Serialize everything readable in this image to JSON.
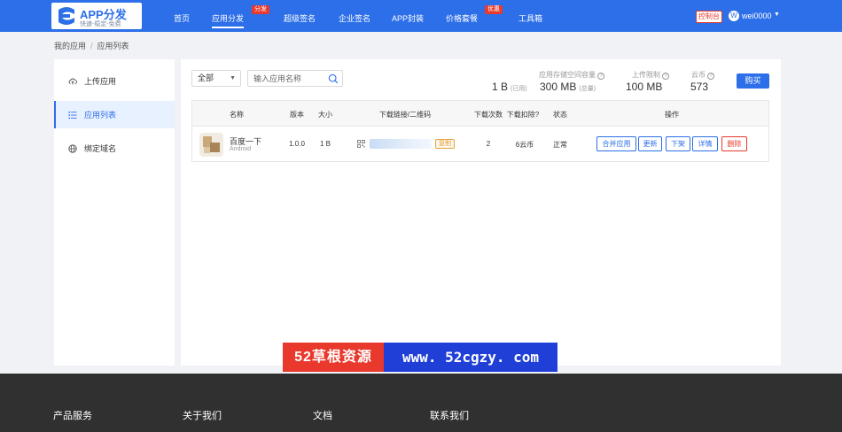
{
  "header": {
    "logo_title": "APP分发",
    "logo_subtitle": "快速-稳定-免费",
    "nav": [
      {
        "label": "首页"
      },
      {
        "label": "应用分发",
        "badge": "分发",
        "active": true
      },
      {
        "label": "超级签名"
      },
      {
        "label": "企业签名"
      },
      {
        "label": "APP封装"
      },
      {
        "label": "价格套餐",
        "badge": "优惠"
      },
      {
        "label": "工具箱"
      }
    ],
    "console_label": "控制台",
    "user_initial": "W",
    "username": "wei0000",
    "caret": "▼"
  },
  "breadcrumb": {
    "root": "我的应用",
    "separator": "/",
    "current": "应用列表"
  },
  "sidebar": {
    "items": [
      {
        "label": "上传应用",
        "icon": "cloud-upload-icon"
      },
      {
        "label": "应用列表",
        "icon": "list-icon",
        "active": true
      },
      {
        "label": "绑定域名",
        "icon": "globe-icon"
      }
    ]
  },
  "toolbar": {
    "filter_value": "全部",
    "filter_caret": "▼",
    "search_placeholder": "输入应用名称"
  },
  "stats": {
    "storage_label": "应用存储空间容量",
    "storage_used": "1 B",
    "storage_used_note": "(已用)",
    "storage_total": "300 MB",
    "storage_total_note": "(总量)",
    "upload_limit_label": "上传限制",
    "upload_limit_value": "100 MB",
    "coin_label": "云币",
    "coin_value": "573",
    "help_glyph": "?",
    "buy_label": "购买"
  },
  "table": {
    "headers": [
      "名称",
      "版本",
      "大小",
      "下载链接/二维码",
      "下载次数",
      "下载扣除?",
      "状态",
      "操作"
    ],
    "rows": [
      {
        "name": "百度一下",
        "platform": "Android",
        "version": "1.0.0",
        "size": "1 B",
        "link_prefix": "h",
        "copy_label": "复制",
        "downloads": "2",
        "deduction": "6云币",
        "status": "正常",
        "actions": [
          "合并应用",
          "更新",
          "下架",
          "详情",
          "删除"
        ]
      }
    ]
  },
  "banner": {
    "left": "52草根资源",
    "right": "www. 52cgzy. com"
  },
  "footer": {
    "columns": [
      "产品服务",
      "关于我们",
      "文档",
      "联系我们"
    ]
  },
  "colors": {
    "primary": "#2d6fe8",
    "danger": "#e8392c",
    "warning": "#e6a23c",
    "footer_bg": "#303030"
  }
}
